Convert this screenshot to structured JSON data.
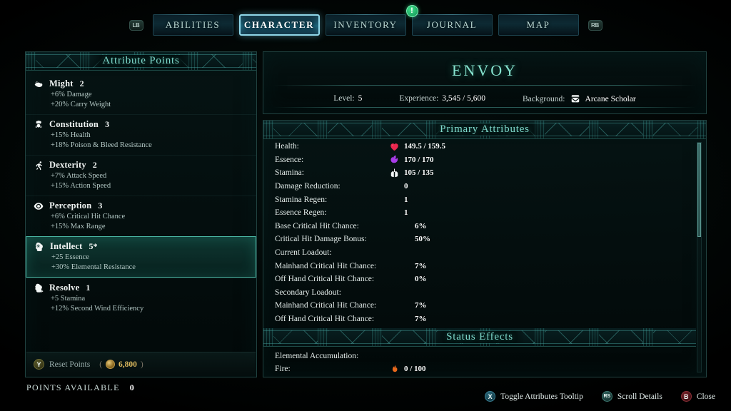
{
  "tabbar": {
    "left_shoulder": "LB",
    "right_shoulder": "RB",
    "tabs": [
      {
        "label": "ABILITIES",
        "active": false,
        "badge": null
      },
      {
        "label": "CHARACTER",
        "active": true,
        "badge": null
      },
      {
        "label": "INVENTORY",
        "active": false,
        "badge": null
      },
      {
        "label": "JOURNAL",
        "active": false,
        "badge": "!"
      },
      {
        "label": "MAP",
        "active": false,
        "badge": null
      }
    ]
  },
  "left_panel": {
    "title": "Attribute Points",
    "attributes": [
      {
        "icon": "bicep-icon",
        "name": "Might",
        "value": "2",
        "selected": false,
        "bonuses": [
          "+6% Damage",
          "+20% Carry Weight"
        ]
      },
      {
        "icon": "shield-icon",
        "name": "Constitution",
        "value": "3",
        "selected": false,
        "bonuses": [
          "+15% Health",
          "+18% Poison & Bleed Resistance"
        ]
      },
      {
        "icon": "runner-icon",
        "name": "Dexterity",
        "value": "2",
        "selected": false,
        "bonuses": [
          "+7% Attack Speed",
          "+15% Action Speed"
        ]
      },
      {
        "icon": "eye-icon",
        "name": "Perception",
        "value": "3",
        "selected": false,
        "bonuses": [
          "+6% Critical Hit Chance",
          "+15% Max Range"
        ]
      },
      {
        "icon": "brain-icon",
        "name": "Intellect",
        "value": "5*",
        "selected": true,
        "bonuses": [
          "+25 Essence",
          "+30% Elemental Resistance"
        ]
      },
      {
        "icon": "resolve-icon",
        "name": "Resolve",
        "value": "1",
        "selected": false,
        "bonuses": [
          "+5 Stamina",
          "+12% Second Wind Efficiency"
        ]
      }
    ],
    "reset": {
      "button": "Y",
      "label": "Reset Points",
      "cost_open": "(",
      "cost": "6,800",
      "cost_close": ")"
    }
  },
  "character": {
    "name": "ENVOY",
    "level_label": "Level:",
    "level_value": "5",
    "experience_label": "Experience:",
    "experience_value": "3,545 / 5,600",
    "background_label": "Background:",
    "background_value": "Arcane Scholar",
    "background_icon": "scroll-icon"
  },
  "primary_attributes": {
    "title": "Primary Attributes",
    "rows": [
      {
        "label": "Health:",
        "icon": "heart-icon",
        "value": "149.5 / 159.5"
      },
      {
        "label": "Essence:",
        "icon": "essence-icon",
        "value": "170 / 170"
      },
      {
        "label": "Stamina:",
        "icon": "lungs-icon",
        "value": "105 / 135"
      },
      {
        "label": "Damage Reduction:",
        "icon": null,
        "value": "0"
      },
      {
        "label": "Stamina Regen:",
        "icon": null,
        "value": "1"
      },
      {
        "label": "Essence Regen:",
        "icon": null,
        "value": "1"
      },
      {
        "label": "Base Critical Hit Chance:",
        "icon": null,
        "value": "6%"
      },
      {
        "label": "Critical Hit Damage Bonus:",
        "icon": null,
        "value": "50%"
      },
      {
        "label": "Current Loadout:",
        "icon": null,
        "value": ""
      },
      {
        "label": "Mainhand Critical Hit Chance:",
        "icon": null,
        "value": "7%"
      },
      {
        "label": "Off Hand Critical Hit Chance:",
        "icon": null,
        "value": "0%"
      },
      {
        "label": "Secondary Loadout:",
        "icon": null,
        "value": ""
      },
      {
        "label": "Mainhand Critical Hit Chance:",
        "icon": null,
        "value": "7%"
      },
      {
        "label": "Off Hand Critical Hit Chance:",
        "icon": null,
        "value": "7%"
      }
    ]
  },
  "status_effects": {
    "title": "Status Effects",
    "rows": [
      {
        "label": "Elemental Accumulation:",
        "icon": null,
        "value": ""
      },
      {
        "label": "Fire:",
        "icon": "flame-icon",
        "value": "0 / 100"
      }
    ]
  },
  "footer": {
    "points_available_label": "POINTS AVAILABLE",
    "points_available_value": "0",
    "hints": [
      {
        "button": "X",
        "label": "Toggle Attributes Tooltip",
        "style": "x"
      },
      {
        "button": "RS",
        "label": "Scroll Details",
        "style": "rs"
      },
      {
        "button": "B",
        "label": "Close",
        "style": "b"
      }
    ]
  },
  "colors": {
    "accent_teal": "#7fd9cc",
    "title_teal": "#86e2ce",
    "health_red": "#e8274e",
    "essence_purple": "#a83ce8",
    "stamina_white": "#f2f6f5",
    "fire_orange": "#e8681c",
    "gold": "#d9b65c",
    "selected_border": "#49b3a0"
  }
}
